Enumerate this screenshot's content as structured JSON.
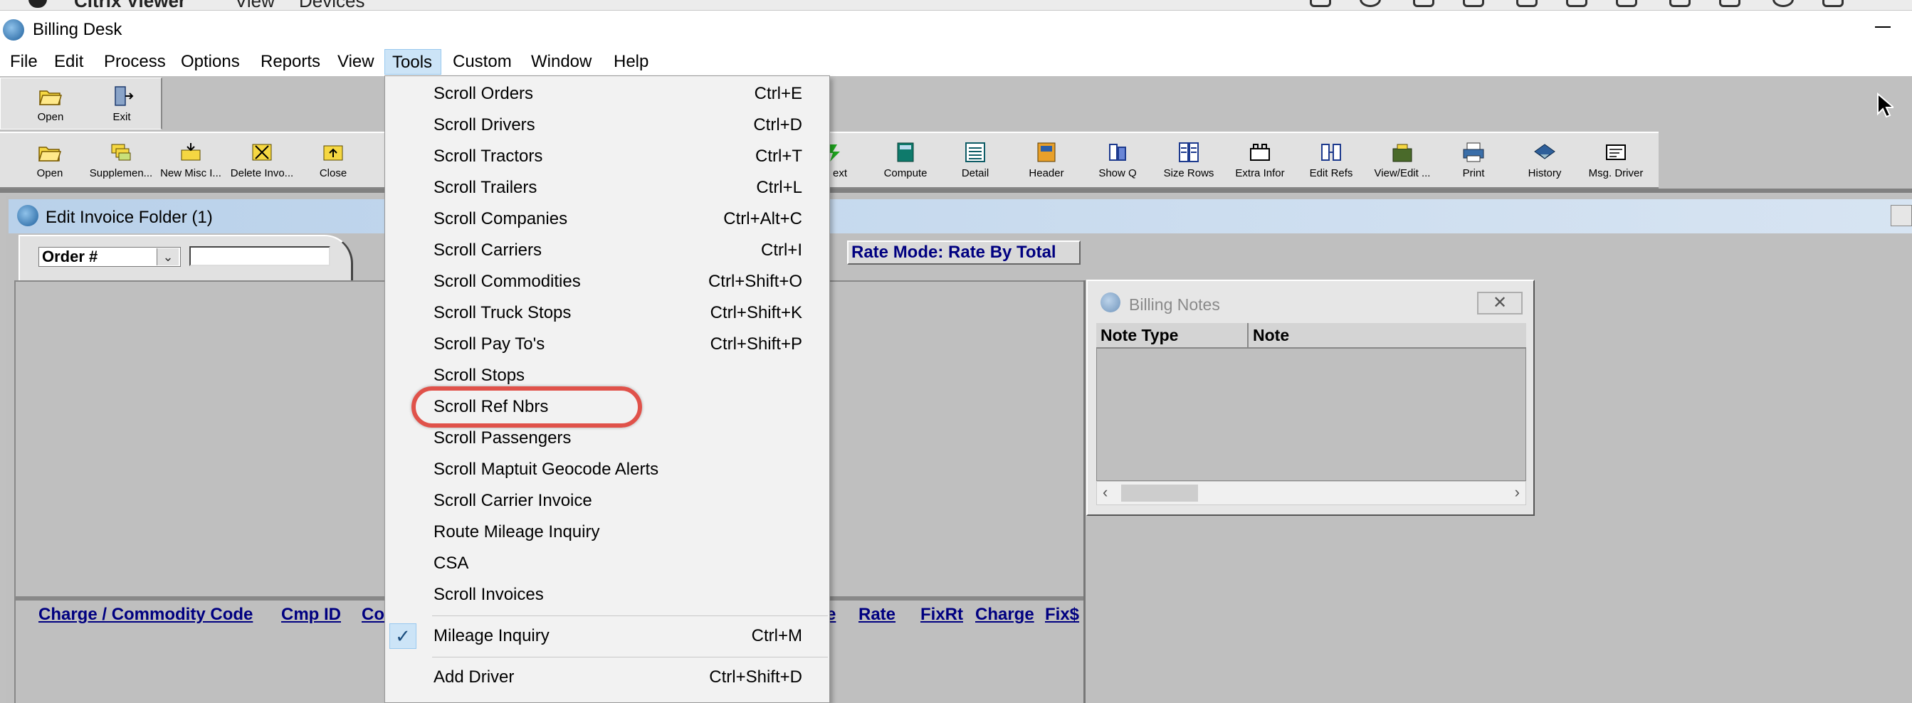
{
  "os_bar": {
    "app_name": "Citrix Viewer",
    "menus": [
      "View",
      "Devices"
    ]
  },
  "window": {
    "title": "Billing Desk"
  },
  "menubar": {
    "items": [
      "File",
      "Edit",
      "Process",
      "Options",
      "Reports",
      "View",
      "Tools",
      "Custom",
      "Window",
      "Help"
    ],
    "active": "Tools"
  },
  "toolbar_top": {
    "buttons": [
      {
        "label": "Open",
        "icon": "folder-open-icon"
      },
      {
        "label": "Exit",
        "icon": "exit-door-icon"
      }
    ]
  },
  "toolbar_main": {
    "buttons": [
      {
        "label": "Open",
        "icon": "folder-open-icon"
      },
      {
        "label": "Supplemen...",
        "icon": "supplement-icon"
      },
      {
        "label": "New Misc I...",
        "icon": "new-misc-icon"
      },
      {
        "label": "Delete Invo...",
        "icon": "delete-invoice-icon"
      },
      {
        "label": "Close",
        "icon": "close-folder-icon"
      },
      {
        "label": "ext",
        "icon": "next-icon"
      },
      {
        "label": "Compute",
        "icon": "compute-icon"
      },
      {
        "label": "Detail",
        "icon": "detail-icon"
      },
      {
        "label": "Header",
        "icon": "header-icon"
      },
      {
        "label": "Show Q",
        "icon": "show-q-icon"
      },
      {
        "label": "Size Rows",
        "icon": "size-rows-icon"
      },
      {
        "label": "Extra Infor",
        "icon": "extra-info-icon"
      },
      {
        "label": "Edit Refs",
        "icon": "edit-refs-icon"
      },
      {
        "label": "View/Edit ...",
        "icon": "view-edit-icon"
      },
      {
        "label": "Print",
        "icon": "printer-icon"
      },
      {
        "label": "History",
        "icon": "history-icon"
      },
      {
        "label": "Msg. Driver",
        "icon": "message-driver-icon"
      }
    ]
  },
  "edit_invoice": {
    "title": "Edit Invoice Folder (1)",
    "order_field_label": "Order #",
    "order_field_value": "",
    "rate_mode": "Rate Mode: Rate By Total",
    "charge_headers": [
      "Charge / Commodity Code",
      "Cmp ID",
      "Co",
      "e",
      "Rate",
      "FixRt",
      "Charge",
      "Fix$"
    ]
  },
  "billing_notes": {
    "title": "Billing Notes",
    "close_glyph": "✕",
    "columns": [
      "Note Type",
      "Note"
    ]
  },
  "tools_menu": {
    "items": [
      {
        "label": "Scroll Orders",
        "shortcut": "Ctrl+E"
      },
      {
        "label": "Scroll Drivers",
        "shortcut": "Ctrl+D"
      },
      {
        "label": "Scroll Tractors",
        "shortcut": "Ctrl+T"
      },
      {
        "label": "Scroll Trailers",
        "shortcut": "Ctrl+L"
      },
      {
        "label": "Scroll Companies",
        "shortcut": "Ctrl+Alt+C"
      },
      {
        "label": "Scroll Carriers",
        "shortcut": "Ctrl+I"
      },
      {
        "label": "Scroll Commodities",
        "shortcut": "Ctrl+Shift+O"
      },
      {
        "label": "Scroll Truck Stops",
        "shortcut": "Ctrl+Shift+K"
      },
      {
        "label": "Scroll Pay To's",
        "shortcut": "Ctrl+Shift+P"
      },
      {
        "label": "Scroll Stops",
        "shortcut": ""
      },
      {
        "label": "Scroll Ref Nbrs",
        "shortcut": "",
        "highlighted": true
      },
      {
        "label": "Scroll Passengers",
        "shortcut": ""
      },
      {
        "label": "Scroll Maptuit Geocode Alerts",
        "shortcut": ""
      },
      {
        "label": "Scroll Carrier Invoice",
        "shortcut": ""
      },
      {
        "label": "Route Mileage Inquiry",
        "shortcut": ""
      },
      {
        "label": "CSA",
        "shortcut": ""
      },
      {
        "label": "Scroll Invoices",
        "shortcut": ""
      },
      {
        "label": "Mileage Inquiry",
        "shortcut": "Ctrl+M",
        "checked": true
      },
      {
        "label": "Add Driver",
        "shortcut": "Ctrl+Shift+D"
      }
    ]
  },
  "colors": {
    "menu_active": "#cce4f7",
    "highlight_ring": "#e0524a",
    "link_blue": "#000080"
  }
}
